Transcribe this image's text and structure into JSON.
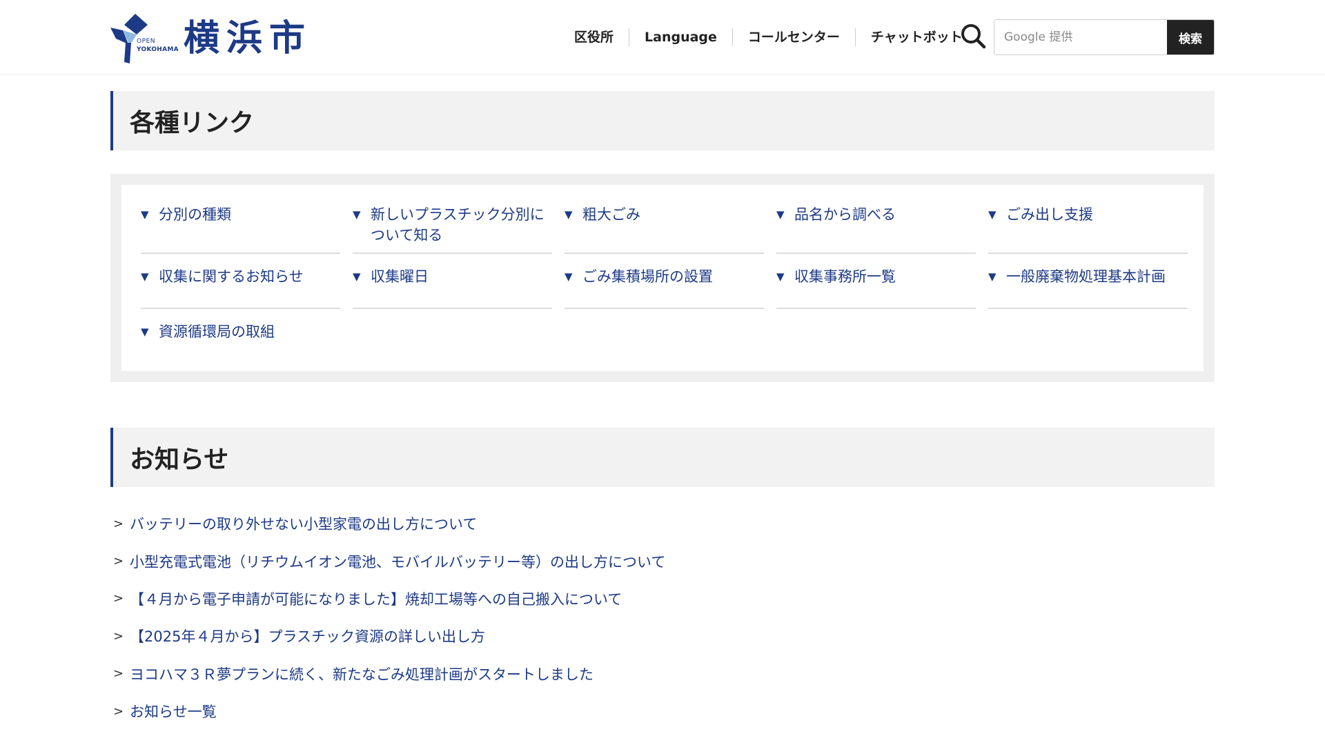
{
  "header": {
    "logo_open": "OPEN",
    "logo_yokohama": "YOKOHAMA",
    "logo_text": "横浜市",
    "nav": [
      {
        "label": "区役所"
      },
      {
        "label": "Language"
      },
      {
        "label": "コールセンター"
      },
      {
        "label": "チャットボット"
      }
    ],
    "search": {
      "placeholder": "Google 提供",
      "button_label": "検索"
    }
  },
  "links_section": {
    "heading": "各種リンク",
    "items": [
      {
        "label": "分別の種類",
        "icon": "triangle-down-icon"
      },
      {
        "label": "新しいプラスチック分別について知る",
        "icon": "triangle-down-icon"
      },
      {
        "label": "粗大ごみ",
        "icon": "triangle-down-icon"
      },
      {
        "label": "品名から調べる",
        "icon": "triangle-down-icon"
      },
      {
        "label": "ごみ出し支援",
        "icon": "triangle-down-icon"
      },
      {
        "label": "収集に関するお知らせ",
        "icon": "triangle-down-icon"
      },
      {
        "label": "収集曜日",
        "icon": "triangle-down-icon"
      },
      {
        "label": "ごみ集積場所の設置",
        "icon": "triangle-down-icon"
      },
      {
        "label": "収集事務所一覧",
        "icon": "triangle-down-icon"
      },
      {
        "label": "一般廃棄物処理基本計画",
        "icon": "triangle-down-icon"
      },
      {
        "label": "資源循環局の取組",
        "icon": "triangle-down-icon"
      }
    ]
  },
  "news_section": {
    "heading": "お知らせ",
    "items": [
      {
        "label": "バッテリーの取り外せない小型家電の出し方について"
      },
      {
        "label": "小型充電式電池（リチウムイオン電池、モバイルバッテリー等）の出し方について"
      },
      {
        "label": "【４月から電子申請が可能になりました】焼却工場等への自己搬入について"
      },
      {
        "label": "【2025年４月から】プラスチック資源の詳しい出し方"
      },
      {
        "label": "ヨコハマ３Ｒ夢プランに続く、新たなごみ処理計画がスタートしました"
      },
      {
        "label": "お知らせ一覧"
      }
    ]
  },
  "colors": {
    "brand": "#1d3a86",
    "heading_bg": "#f2f2f2",
    "panel_bg": "#efefef",
    "search_button_bg": "#222222"
  }
}
